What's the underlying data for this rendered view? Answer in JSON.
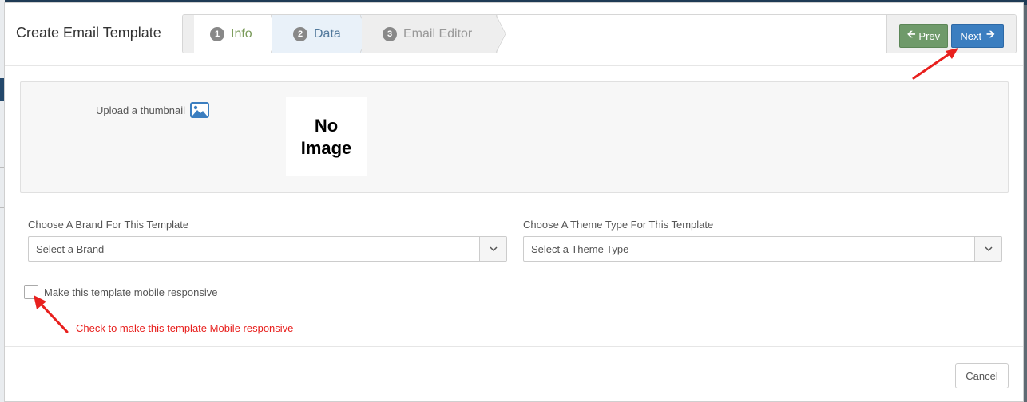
{
  "modal": {
    "title": "Create Email Template"
  },
  "wizard": {
    "steps": [
      {
        "number": "1",
        "label": "Info",
        "state": "completed"
      },
      {
        "number": "2",
        "label": "Data",
        "state": "active"
      },
      {
        "number": "3",
        "label": "Email Editor",
        "state": "pending"
      }
    ],
    "prev_label": "Prev",
    "next_label": "Next"
  },
  "upload": {
    "label": "Upload a thumbnail",
    "placeholder_line1": "No",
    "placeholder_line2": "Image"
  },
  "brand": {
    "label": "Choose A Brand For This Template",
    "value": "Select a Brand"
  },
  "theme": {
    "label": "Choose A Theme Type For This Template",
    "value": "Select a Theme Type"
  },
  "mobile": {
    "label": "Make this template mobile responsive",
    "checked": false,
    "hint": "Check to make this template Mobile responsive"
  },
  "footer": {
    "cancel_label": "Cancel"
  },
  "colors": {
    "prev_button": "#6f9a6a",
    "next_button": "#3b7ec0",
    "annotation": "#e8201e"
  }
}
